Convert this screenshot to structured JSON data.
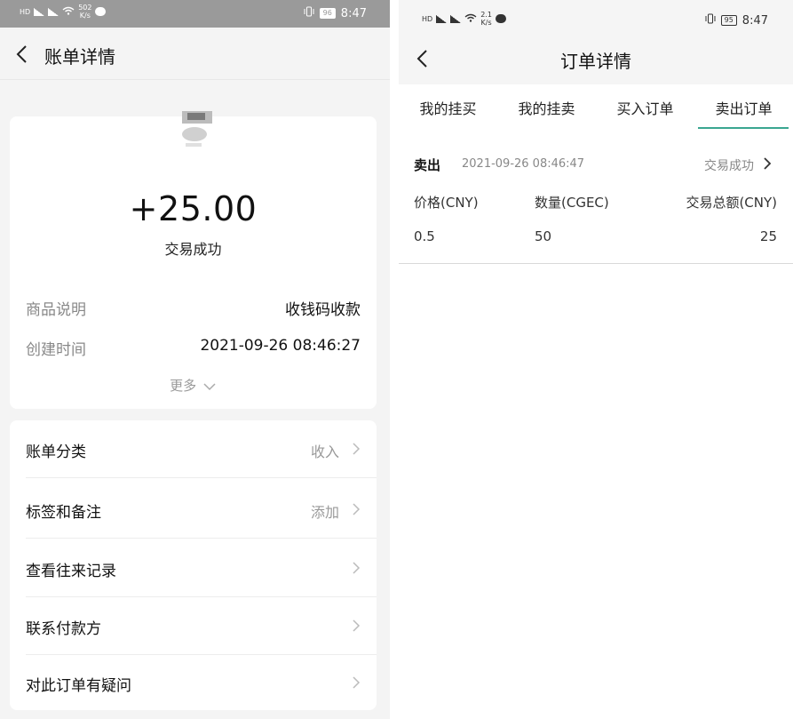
{
  "left": {
    "status_bar": {
      "net_speed": "502",
      "net_unit": "K/s",
      "battery": "96",
      "time": "8:47"
    },
    "nav": {
      "title": "账单详情"
    },
    "summary": {
      "amount": "+25.00",
      "status": "交易成功",
      "details": [
        {
          "key": "商品说明",
          "value": "收钱码收款"
        },
        {
          "key": "创建时间",
          "value": "2021-09-26 08:46:27"
        }
      ],
      "more_label": "更多"
    },
    "menu": [
      {
        "label": "账单分类",
        "value": "收入"
      },
      {
        "label": "标签和备注",
        "value": "添加"
      },
      {
        "label": "查看往来记录",
        "value": ""
      },
      {
        "label": "联系付款方",
        "value": ""
      },
      {
        "label": "对此订单有疑问",
        "value": ""
      }
    ]
  },
  "right": {
    "status_bar": {
      "net_speed": "2.1",
      "net_unit": "K/s",
      "battery": "95",
      "time": "8:47"
    },
    "nav": {
      "title": "订单详情"
    },
    "tabs": [
      {
        "label": "我的挂买"
      },
      {
        "label": "我的挂卖"
      },
      {
        "label": "买入订单"
      },
      {
        "label": "卖出订单"
      }
    ],
    "active_tab": 3,
    "accent_color": "#3aa691",
    "order": {
      "type": "卖出",
      "time": "2021-09-26 08:46:47",
      "status": "交易成功",
      "headers": {
        "price": "价格(CNY)",
        "qty": "数量(CGEC)",
        "total": "交易总额(CNY)"
      },
      "values": {
        "price": "0.5",
        "qty": "50",
        "total": "25"
      }
    }
  }
}
